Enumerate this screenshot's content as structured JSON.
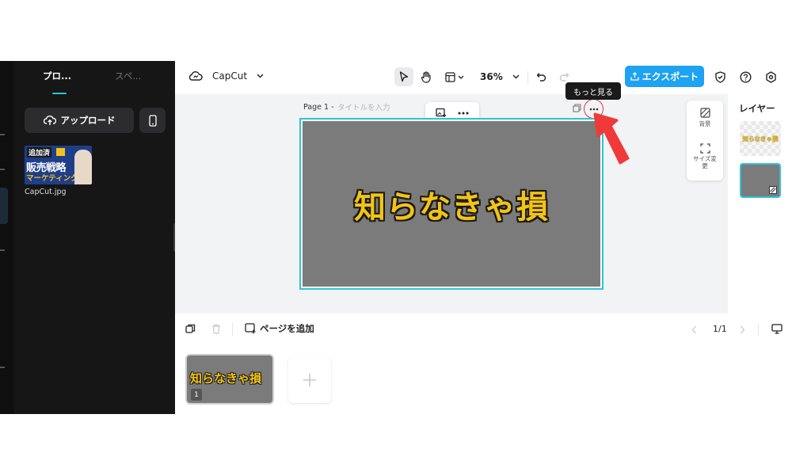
{
  "left_panel": {
    "tabs": [
      {
        "label": "プロ..."
      },
      {
        "label": "スペ..."
      }
    ],
    "upload_label": "アップロード",
    "asset": {
      "filename": "CapCut.jpg",
      "thumb_text_top": "追加済",
      "thumb_text_main": "販売戦略",
      "thumb_text_sub": "マーケティング"
    }
  },
  "toolbar": {
    "project_name": "CapCut",
    "zoom": "36%",
    "export_label": "エクスポート"
  },
  "canvas": {
    "page_label": "Page 1 -",
    "title_placeholder": "タイトルを入力",
    "slide_text": "知らなきゃ損",
    "tooltip": "もっと見る",
    "side_tools": [
      {
        "label": "背景"
      },
      {
        "label": "サイズ変更"
      }
    ]
  },
  "layers": {
    "title": "レイヤー",
    "text_layer_preview": "知らなきゃ損"
  },
  "bottom": {
    "add_page_label": "ページを追加",
    "page_count": "1/1",
    "pages": [
      {
        "text": "知らなきゃ損",
        "number": "1"
      }
    ]
  },
  "colors": {
    "accent": "#2ec4d6",
    "export_button": "#1ea2f2",
    "slide_background": "#7b7b7b",
    "slide_text": "#f4c414",
    "arrow": "#f03a3a"
  }
}
